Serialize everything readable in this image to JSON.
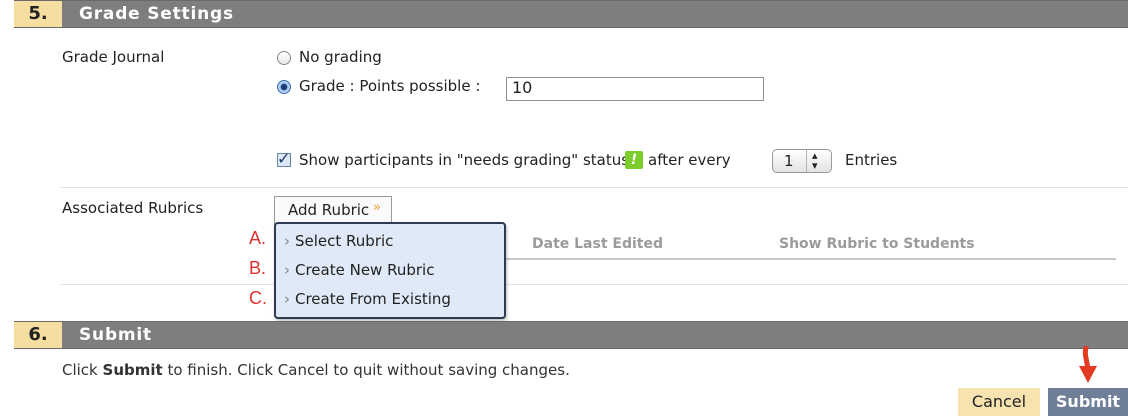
{
  "section5": {
    "number": "5.",
    "title": "Grade Settings",
    "grade_journal_label": "Grade Journal",
    "no_grading_label": "No grading",
    "grade_label": "Grade : Points possible :",
    "points_possible_value": "10",
    "needs_grading_text": "Show participants in \"needs grading\" status",
    "after_every_text": "after every",
    "entries_count": "1",
    "entries_label": "Entries",
    "associated_rubrics_label": "Associated Rubrics",
    "add_rubric_label": "Add Rubric",
    "rubric_menu": [
      {
        "marker": "A.",
        "label": "Select Rubric"
      },
      {
        "marker": "B.",
        "label": "Create New Rubric"
      },
      {
        "marker": "C.",
        "label": "Create From Existing"
      }
    ],
    "table_headers": {
      "date_last_edited": "Date Last Edited",
      "show_rubric": "Show Rubric to Students"
    }
  },
  "section6": {
    "number": "6.",
    "title": "Submit",
    "instruction_parts": [
      "Click ",
      "Submit",
      " to finish. Click ",
      "Cancel",
      " to quit without saving changes."
    ],
    "cancel_label": "Cancel",
    "submit_label": "Submit"
  },
  "colors": {
    "header_bg": "#7e7e7e",
    "number_bg": "#f6dea0",
    "menu_bg": "#dfe9f7",
    "marker_red": "#e0312c",
    "submit_bg": "#6f7f98",
    "cancel_bg": "#f6e3b0"
  },
  "icons": {
    "needs_grading": "green-exclamation-icon",
    "arrow": "red-down-arrow-icon"
  }
}
